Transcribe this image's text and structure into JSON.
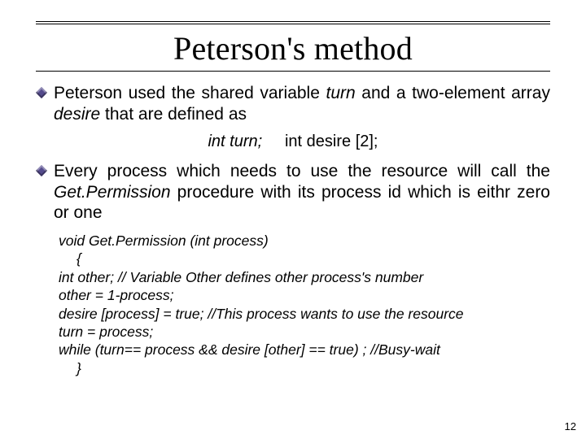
{
  "title": "Peterson's method",
  "bullets": {
    "b1": {
      "pre": "Peterson used the shared variable ",
      "var1": "turn",
      "mid": " and a two-element array ",
      "var2": "desire",
      "post": " that are defined as"
    },
    "decl": {
      "lhs": "int turn;",
      "rhs": "int desire [2];"
    },
    "b2": {
      "pre": "Every process which needs to use the resource will call the ",
      "proc": "Get.Permission",
      "post": " procedure with its process id which is eithr zero or one"
    }
  },
  "code": {
    "l1": "void Get.Permission (int  process)",
    "l2": "{",
    "l3": "int other;              // Variable Other defines other process's number",
    "l4": "other = 1-process;",
    "l5": "desire [process] = true;  //This process wants to use the resource",
    "l6": "turn = process;",
    "l7": "while (turn== process && desire [other] == true) ; //Busy-wait",
    "l8": "}"
  },
  "page": "12"
}
